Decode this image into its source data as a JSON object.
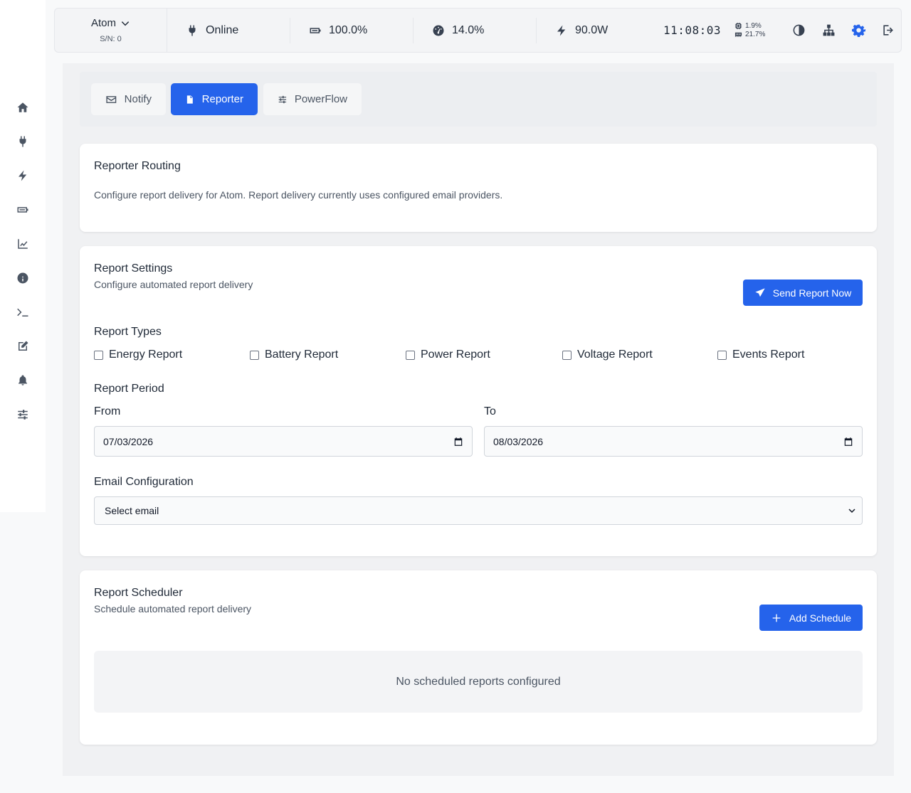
{
  "device": {
    "name": "Atom",
    "serial": "S/N: 0"
  },
  "status": {
    "connection": "Online",
    "battery": "100.0%",
    "load": "14.0%",
    "power": "90.0W",
    "clock": "11:08:03",
    "cpu": "1.9%",
    "memory": "21.7%"
  },
  "sidebar": {
    "items": [
      {
        "icon": "home-icon"
      },
      {
        "icon": "plug-icon"
      },
      {
        "icon": "bolt-icon"
      },
      {
        "icon": "battery-icon"
      },
      {
        "icon": "chart-line-icon"
      },
      {
        "icon": "info-icon"
      },
      {
        "icon": "terminal-icon"
      },
      {
        "icon": "edit-icon"
      },
      {
        "icon": "bell-icon"
      },
      {
        "icon": "sliders-icon"
      }
    ]
  },
  "tabs": [
    {
      "label": "Notify",
      "icon": "envelope-icon"
    },
    {
      "label": "Reporter",
      "icon": "file-icon",
      "active": true
    },
    {
      "label": "PowerFlow",
      "icon": "sliders-icon"
    }
  ],
  "routing": {
    "title": "Reporter Routing",
    "description": "Configure report delivery for Atom. Report delivery currently uses configured email providers."
  },
  "settings": {
    "title": "Report Settings",
    "subtitle": "Configure automated report delivery",
    "send_button": "Send Report Now",
    "types_label": "Report Types",
    "types": [
      "Energy Report",
      "Battery Report",
      "Power Report",
      "Voltage Report",
      "Events Report"
    ],
    "period_label": "Report Period",
    "from_label": "From",
    "from_value": "07/03/2026",
    "to_label": "To",
    "to_value": "08/03/2026",
    "email_label": "Email Configuration",
    "email_value": "Select email"
  },
  "scheduler": {
    "title": "Report Scheduler",
    "subtitle": "Schedule automated report delivery",
    "add_button": "Add Schedule",
    "empty": "No scheduled reports configured"
  },
  "colors": {
    "accent": "#2563eb",
    "background": "#f0f1f3",
    "card": "#ffffff"
  }
}
